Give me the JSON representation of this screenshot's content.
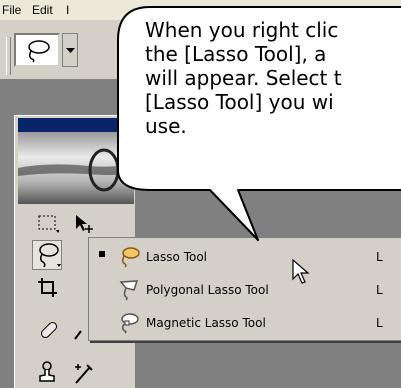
{
  "menubar": {
    "items": [
      "File",
      "Edit",
      "I"
    ]
  },
  "callout": {
    "lines": [
      "When you right clic",
      "the [Lasso Tool], a",
      "will appear. Select t",
      "[Lasso Tool] you wi",
      "use."
    ]
  },
  "flyout": {
    "items": [
      {
        "label": "Lasso Tool",
        "shortcut": "L",
        "selected": true,
        "icon": "lasso-icon"
      },
      {
        "label": "Polygonal Lasso Tool",
        "shortcut": "L",
        "selected": false,
        "icon": "polygonal-lasso-icon"
      },
      {
        "label": "Magnetic Lasso Tool",
        "shortcut": "L",
        "selected": false,
        "icon": "magnetic-lasso-icon"
      }
    ]
  },
  "colors": {
    "bubble_fill": "#ffffff",
    "bubble_stroke": "#000000",
    "toolbox_title": "#0a246a"
  }
}
